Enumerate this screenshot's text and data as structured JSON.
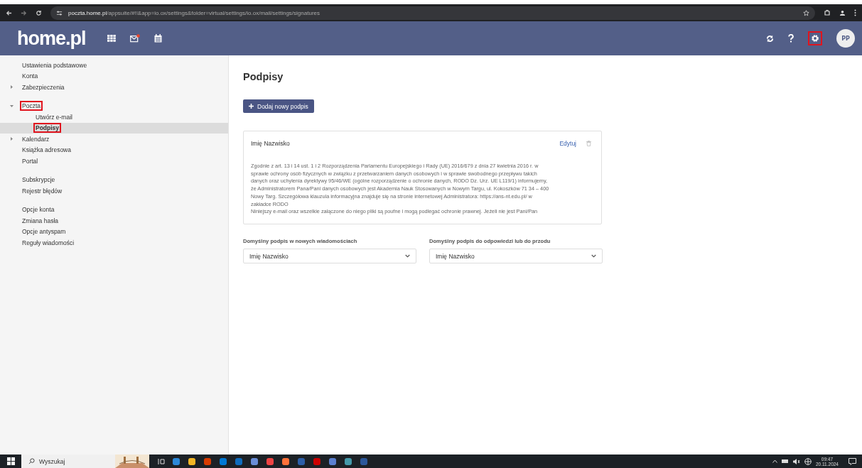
{
  "browser": {
    "url_host": "poczta.home.pl",
    "url_path": "/appsuite/#!!&app=io.ox/settings&folder=virtual/settings/io.ox/mail/settings/signatures"
  },
  "header": {
    "logo": "home.pl",
    "mail_unread": true,
    "settings_highlighted": true,
    "avatar": "PP"
  },
  "sidebar": {
    "sections": [
      {
        "items": [
          {
            "label": "Ustawienia podstawowe",
            "selected": false,
            "highlighted": false
          },
          {
            "label": "Konta",
            "selected": false,
            "highlighted": false
          },
          {
            "label": "Zabezpieczenia",
            "selected": false,
            "highlighted": false,
            "expanded": false
          }
        ]
      },
      {
        "items": [
          {
            "label": "Poczta",
            "selected": false,
            "highlighted": true,
            "expanded": true,
            "children": [
              {
                "label": "Utwórz e-mail",
                "selected": false,
                "highlighted": false
              },
              {
                "label": "Podpisy",
                "selected": true,
                "highlighted": true
              }
            ]
          },
          {
            "label": "Kalendarz",
            "selected": false,
            "highlighted": false,
            "expanded": false
          },
          {
            "label": "Książka adresowa",
            "selected": false,
            "highlighted": false
          },
          {
            "label": "Portal",
            "selected": false,
            "highlighted": false
          }
        ]
      },
      {
        "items": [
          {
            "label": "Subskrypcje",
            "selected": false,
            "highlighted": false
          },
          {
            "label": "Rejestr błędów",
            "selected": false,
            "highlighted": false
          }
        ]
      },
      {
        "items": [
          {
            "label": "Opcje konta",
            "selected": false,
            "highlighted": false
          },
          {
            "label": "Zmiana hasła",
            "selected": false,
            "highlighted": false
          },
          {
            "label": "Opcje antyspam",
            "selected": false,
            "highlighted": false
          },
          {
            "label": "Reguły wiadomości",
            "selected": false,
            "highlighted": false
          }
        ]
      }
    ]
  },
  "content": {
    "title": "Podpisy",
    "add_button": "Dodaj nowy podpis",
    "signature": {
      "name": "Imię Nazwisko",
      "edit": "Edytuj",
      "lines": [
        "Zgodnie z art. 13 i 14 ust. 1 i 2 Rozporządzenia Parlamentu Europejskiego i Rady (UE) 2016/679 z dnia 27 kwietnia 2016 r. w",
        "sprawie ochrony osób fizycznych w związku z przetwarzaniem danych osobowych i w sprawie swobodnego przepływu takich",
        "danych oraz uchylenia dyrektywy 95/46/WE (ogólne rozporządzenie o ochronie danych, RODO Dz. Urz. UE L119/1) informujemy,",
        "że Administratorem Pana/Pani danych osobowych jest Akademia Nauk Stosowanych w Nowym Targu, ul. Kokoszków 71 34 – 400",
        "Nowy Targ. Szczegółowa klauzula informacyjna znajduje się na stronie internetowej Administratora: https://ans-nt.edu.pl/ w",
        "zakładce RODO",
        "Niniejszy e-mail oraz wszelkie załączone do niego pliki są poufne i mogą podlegać ochronie prawnej. Jeżeli nie jest Pani/Pan"
      ]
    },
    "selects": [
      {
        "label": "Domyślny podpis w nowych wiadomościach",
        "value": "Imię Nazwisko"
      },
      {
        "label": "Domyślny podpis do odpowiedzi lub do przodu",
        "value": "Imię Nazwisko"
      }
    ]
  },
  "taskbar": {
    "search_placeholder": "Wyszukaj",
    "time": "09:47",
    "date": "20.11.2024"
  }
}
